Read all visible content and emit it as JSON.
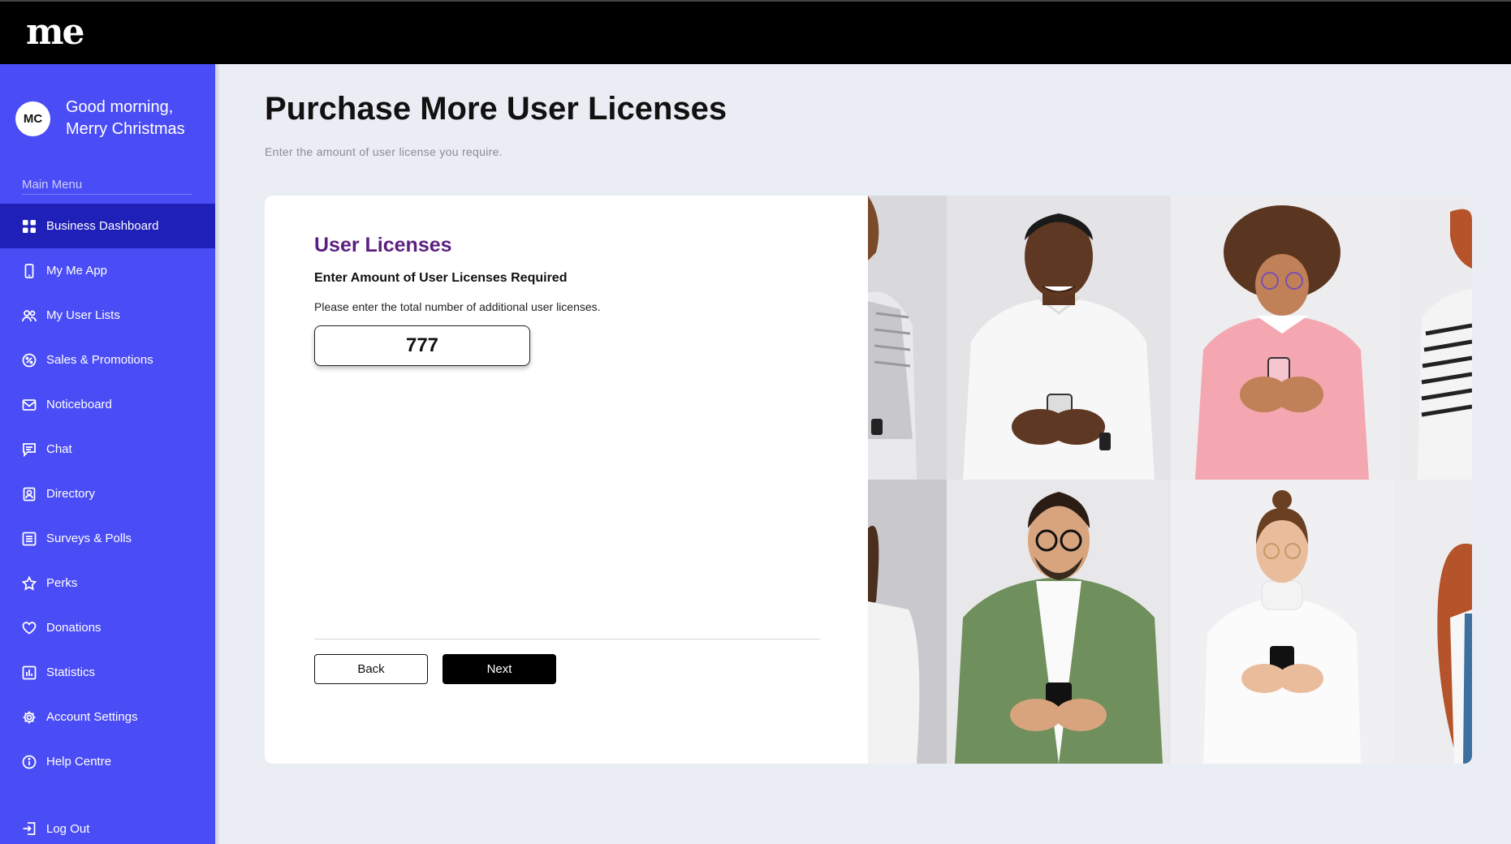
{
  "app": {
    "logo": "me"
  },
  "user": {
    "initials": "MC",
    "greeting_line1": "Good morning,",
    "greeting_line2": "Merry Christmas"
  },
  "sidebar": {
    "menu_label": "Main Menu",
    "items": [
      {
        "label": "Business Dashboard",
        "icon": "grid-icon",
        "active": true
      },
      {
        "label": "My Me App",
        "icon": "phone-icon"
      },
      {
        "label": "My User Lists",
        "icon": "users-icon"
      },
      {
        "label": "Sales & Promotions",
        "icon": "percent-icon"
      },
      {
        "label": "Noticeboard",
        "icon": "mail-icon"
      },
      {
        "label": "Chat",
        "icon": "chat-icon"
      },
      {
        "label": "Directory",
        "icon": "contact-book-icon"
      },
      {
        "label": "Surveys & Polls",
        "icon": "list-icon"
      },
      {
        "label": "Perks",
        "icon": "star-icon"
      },
      {
        "label": "Donations",
        "icon": "heart-icon"
      },
      {
        "label": "Statistics",
        "icon": "bar-chart-icon"
      },
      {
        "label": "Account Settings",
        "icon": "gear-icon"
      },
      {
        "label": "Help Centre",
        "icon": "info-icon"
      }
    ],
    "logout_label": "Log Out"
  },
  "page": {
    "title": "Purchase More User Licenses",
    "subtitle": "Enter the amount of user license you require."
  },
  "form": {
    "section_title": "User Licenses",
    "field_label": "Enter Amount of User Licenses Required",
    "field_help": "Please enter the total number of additional user licenses.",
    "quantity_value": "777",
    "back_label": "Back",
    "next_label": "Next"
  },
  "colors": {
    "sidebar_bg": "#4a4cf5",
    "sidebar_active": "#1f20b8",
    "section_title": "#5b1f80",
    "topbar": "#000000",
    "page_bg": "#ebedf4"
  }
}
